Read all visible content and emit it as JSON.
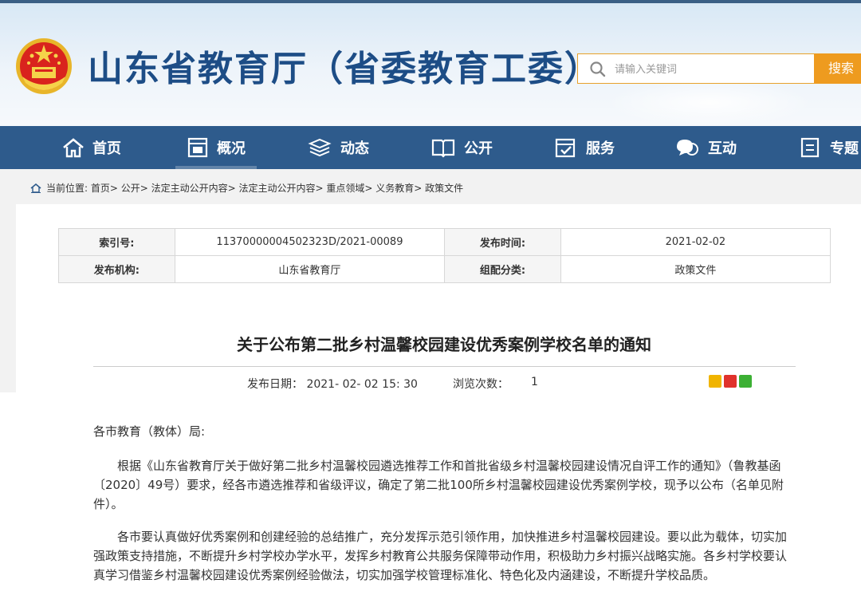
{
  "header": {
    "site_title": "山东省教育厅（省委教育工委）",
    "search_placeholder": "请输入关键词",
    "search_button": "搜索"
  },
  "nav": {
    "items": [
      {
        "label": "首页",
        "icon": "home-icon"
      },
      {
        "label": "概况",
        "icon": "overview-icon"
      },
      {
        "label": "动态",
        "icon": "news-icon"
      },
      {
        "label": "公开",
        "icon": "book-icon"
      },
      {
        "label": "服务",
        "icon": "service-icon"
      },
      {
        "label": "互动",
        "icon": "chat-icon"
      },
      {
        "label": "专题",
        "icon": "topic-icon"
      }
    ],
    "active_index": 1
  },
  "breadcrumb": {
    "text": "当前位置: 首页> 公开> 法定主动公开内容> 法定主动公开内容> 重点领域> 义务教育> 政策文件"
  },
  "meta": {
    "index_label": "索引号:",
    "index_value": "11370000004502323D/2021-00089",
    "publish_time_label": "发布时间:",
    "publish_time_value": "2021-02-02",
    "agency_label": "发布机构:",
    "agency_value": "山东省教育厅",
    "category_label": "组配分类:",
    "category_value": "政策文件"
  },
  "article": {
    "title": "关于公布第二批乡村温馨校园建设优秀案例学校名单的通知",
    "publish_date": "发布日期： 2021- 02- 02 15: 30",
    "views_label": "浏览次数：",
    "views_value": "1",
    "salutation": "各市教育（教体）局:",
    "paragraph1": "根据《山东省教育厅关于做好第二批乡村温馨校园遴选推荐工作和首批省级乡村温馨校园建设情况自评工作的通知》（鲁教基函〔2020〕49号）要求，经各市遴选推荐和省级评议，确定了第二批100所乡村温馨校园建设优秀案例学校，现予以公布（名单见附件）。",
    "paragraph2": "各市要认真做好优秀案例和创建经验的总结推广，充分发挥示范引领作用，加快推进乡村温馨校园建设。要以此为载体，切实加强政策支持措施，不断提升乡村学校办学水平，发挥乡村教育公共服务保障带动作用，积极助力乡村振兴战略实施。各乡村学校要认真学习借鉴乡村温馨校园建设优秀案例经验做法，切实加强学校管理标准化、特色化及内涵建设，不断提升学校品质。"
  },
  "share": [
    "qzone-icon",
    "weibo-icon",
    "wechat-icon"
  ],
  "colors": {
    "brand_blue": "#1d4d86",
    "nav_bg": "#2e5b8c",
    "search_orange": "#ee9b1f"
  }
}
